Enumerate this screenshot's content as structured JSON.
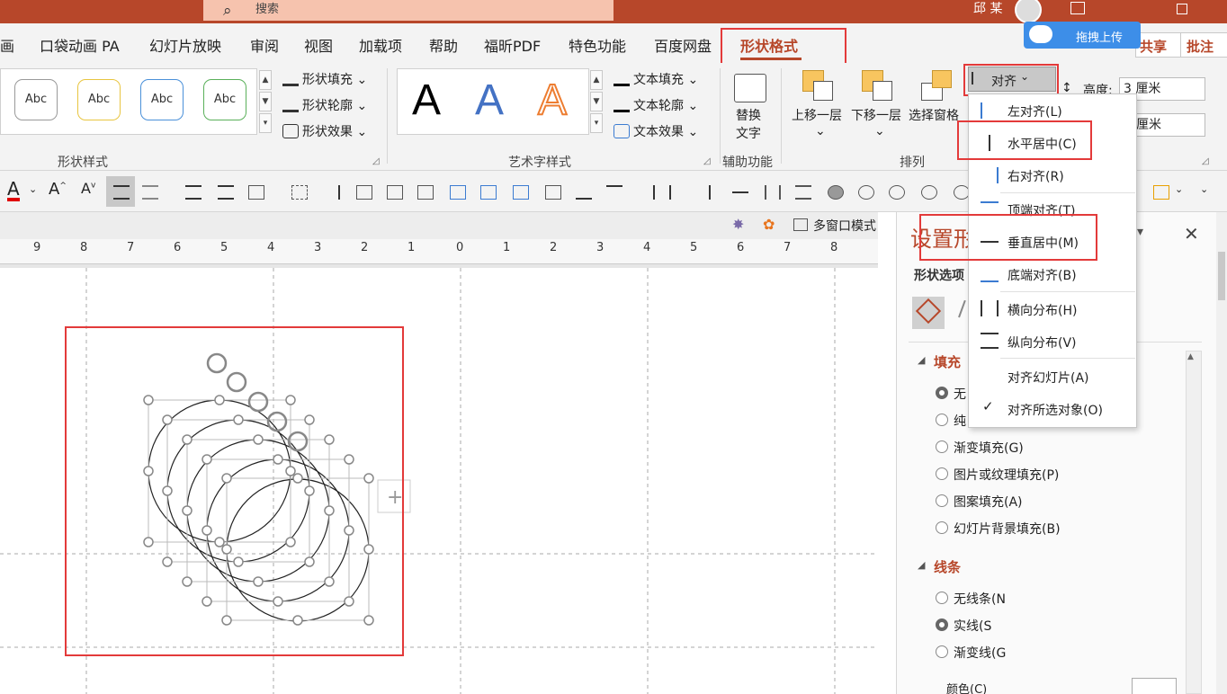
{
  "titlebar": {
    "search_placeholder": "搜索",
    "user_name": "邱 某"
  },
  "tabs": [
    "画",
    "口袋动画 PA",
    "幻灯片放映",
    "审阅",
    "视图",
    "加载项",
    "帮助",
    "福昕PDF",
    "特色功能",
    "百度网盘"
  ],
  "active_tab": "形状格式",
  "share_label": "共享",
  "comment_label": "批注",
  "upload_label": "拖拽上传",
  "ribbon": {
    "shape_style_samples": [
      "Abc",
      "Abc",
      "Abc",
      "Abc"
    ],
    "shape_fill": "形状填充",
    "shape_outline": "形状轮廓",
    "shape_effect": "形状效果",
    "group_shape_styles": "形状样式",
    "wordart_letter": "A",
    "text_fill": "文本填充",
    "text_outline": "文本轮廓",
    "text_effect": "文本效果",
    "group_wordart": "艺术字样式",
    "alt_text_1": "替换",
    "alt_text_2": "文字",
    "group_accessibility": "辅助功能",
    "bring_forward": "上移一层",
    "send_backward": "下移一层",
    "selection_pane": "选择窗格",
    "align_button": "对齐",
    "group_arrange": "排列",
    "height_label": "高度:",
    "height_value": "3 厘米",
    "width_value": "厘米"
  },
  "multiwindow_label": "多窗口模式",
  "ruler_numbers": [
    "9",
    "8",
    "7",
    "6",
    "5",
    "4",
    "3",
    "2",
    "1",
    "0",
    "1",
    "2",
    "3",
    "4",
    "5",
    "6",
    "7",
    "8"
  ],
  "panel": {
    "title": "设置形",
    "shape_options": "形状选项",
    "fill_header": "填充",
    "fill_options": [
      "无",
      "纯",
      "渐变填充(G)",
      "图片或纹理填充(P)",
      "图案填充(A)",
      "幻灯片背景填充(B)"
    ],
    "line_header": "线条",
    "line_options": [
      "无线条(N",
      "实线(S",
      "渐变线(G"
    ],
    "color_label": "颜色(C)"
  },
  "align_menu": {
    "items": [
      {
        "label": "左对齐(L)"
      },
      {
        "label": "水平居中(C)"
      },
      {
        "label": "右对齐(R)"
      },
      {
        "label": "顶端对齐(T)"
      },
      {
        "label": "垂直居中(M)"
      },
      {
        "label": "底端对齐(B)"
      },
      {
        "label": "横向分布(H)"
      },
      {
        "label": "纵向分布(V)"
      },
      {
        "label": "对齐幻灯片(A)"
      },
      {
        "label": "对齐所选对象(O)"
      }
    ],
    "checkmark": "✓"
  },
  "colors": {
    "accent": "#b7472a",
    "highlight": "#e33a3a",
    "upload": "#3d8ee8"
  }
}
